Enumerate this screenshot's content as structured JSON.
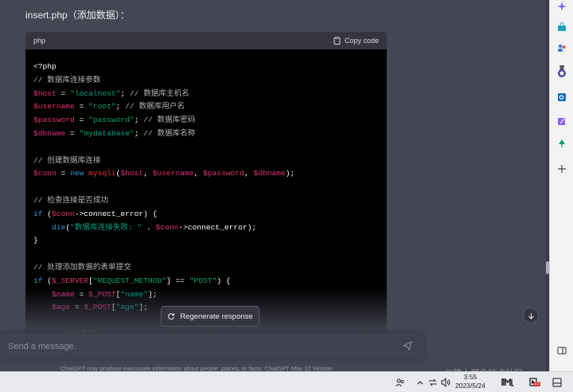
{
  "message": {
    "heading": "insert.php（添加数据）："
  },
  "code": {
    "language": "php",
    "copy_label": "Copy code",
    "lines": [
      [
        {
          "t": "<?php",
          "c": "plain"
        }
      ],
      [
        {
          "t": "// 数据库连接参数",
          "c": "cmt"
        }
      ],
      [
        {
          "t": "$host",
          "c": "var"
        },
        {
          "t": " = ",
          "c": "plain"
        },
        {
          "t": "\"localhost\"",
          "c": "str"
        },
        {
          "t": "; ",
          "c": "plain"
        },
        {
          "t": "// 数据库主机名",
          "c": "cmt"
        }
      ],
      [
        {
          "t": "$username",
          "c": "var"
        },
        {
          "t": " = ",
          "c": "plain"
        },
        {
          "t": "\"root\"",
          "c": "str"
        },
        {
          "t": "; ",
          "c": "plain"
        },
        {
          "t": "// 数据库用户名",
          "c": "cmt"
        }
      ],
      [
        {
          "t": "$password",
          "c": "var"
        },
        {
          "t": " = ",
          "c": "plain"
        },
        {
          "t": "\"password\"",
          "c": "str"
        },
        {
          "t": "; ",
          "c": "plain"
        },
        {
          "t": "// 数据库密码",
          "c": "cmt"
        }
      ],
      [
        {
          "t": "$dbname",
          "c": "var"
        },
        {
          "t": " = ",
          "c": "plain"
        },
        {
          "t": "\"mydatabase\"",
          "c": "str"
        },
        {
          "t": "; ",
          "c": "plain"
        },
        {
          "t": "// 数据库名称",
          "c": "cmt"
        }
      ],
      [],
      [
        {
          "t": "// 创建数据库连接",
          "c": "cmt"
        }
      ],
      [
        {
          "t": "$conn",
          "c": "var"
        },
        {
          "t": " = ",
          "c": "plain"
        },
        {
          "t": "new",
          "c": "kw"
        },
        {
          "t": " ",
          "c": "plain"
        },
        {
          "t": "mysqli",
          "c": "fn"
        },
        {
          "t": "(",
          "c": "plain"
        },
        {
          "t": "$host",
          "c": "var"
        },
        {
          "t": ", ",
          "c": "plain"
        },
        {
          "t": "$username",
          "c": "var"
        },
        {
          "t": ", ",
          "c": "plain"
        },
        {
          "t": "$password",
          "c": "var"
        },
        {
          "t": ", ",
          "c": "plain"
        },
        {
          "t": "$dbname",
          "c": "var"
        },
        {
          "t": ");",
          "c": "plain"
        }
      ],
      [],
      [
        {
          "t": "// 检查连接是否成功",
          "c": "cmt"
        }
      ],
      [
        {
          "t": "if",
          "c": "kw"
        },
        {
          "t": " (",
          "c": "plain"
        },
        {
          "t": "$conn",
          "c": "var"
        },
        {
          "t": "->connect_error) {",
          "c": "plain"
        }
      ],
      [
        {
          "t": "    ",
          "c": "plain"
        },
        {
          "t": "die",
          "c": "kw"
        },
        {
          "t": "(",
          "c": "plain"
        },
        {
          "t": "\"数据库连接失败: \"",
          "c": "str"
        },
        {
          "t": " . ",
          "c": "plain"
        },
        {
          "t": "$conn",
          "c": "var"
        },
        {
          "t": "->connect_error);",
          "c": "plain"
        }
      ],
      [
        {
          "t": "}",
          "c": "plain"
        }
      ],
      [],
      [
        {
          "t": "// 处理添加数据的表单提交",
          "c": "cmt"
        }
      ],
      [
        {
          "t": "if",
          "c": "kw"
        },
        {
          "t": " (",
          "c": "plain"
        },
        {
          "t": "$_SERVER",
          "c": "var"
        },
        {
          "t": "[",
          "c": "plain"
        },
        {
          "t": "\"REQUEST_METHOD\"",
          "c": "str"
        },
        {
          "t": "] == ",
          "c": "plain"
        },
        {
          "t": "\"POST\"",
          "c": "str"
        },
        {
          "t": ") {",
          "c": "plain"
        }
      ],
      [
        {
          "t": "    ",
          "c": "plain"
        },
        {
          "t": "$name",
          "c": "var"
        },
        {
          "t": " = ",
          "c": "plain"
        },
        {
          "t": "$_POST",
          "c": "var"
        },
        {
          "t": "[",
          "c": "plain"
        },
        {
          "t": "\"name\"",
          "c": "str"
        },
        {
          "t": "];",
          "c": "plain"
        }
      ],
      [
        {
          "t": "    ",
          "c": "plain"
        },
        {
          "t": "$age",
          "c": "var"
        },
        {
          "t": " = ",
          "c": "plain"
        },
        {
          "t": "$_POST",
          "c": "var"
        },
        {
          "t": "[",
          "c": "plain"
        },
        {
          "t": "\"age\"",
          "c": "str"
        },
        {
          "t": "];",
          "c": "plain"
        }
      ],
      [],
      [
        {
          "t": "    ",
          "c": "plain"
        },
        {
          "t": "// 插入数据",
          "c": "cmt"
        }
      ]
    ]
  },
  "regenerate": {
    "label": "Regenerate response"
  },
  "composer": {
    "placeholder": "Send a message."
  },
  "disclaimer": "ChatGPT may produce inaccurate information about people, places, or facts. ChatGPT May 12 Version",
  "taskbar": {
    "time": "3:55",
    "date": "2023/5/24",
    "badge": "23"
  },
  "watermark": "@稀土掘金技术社区",
  "colors": {
    "background": "#444654",
    "code_bg": "#000000",
    "string": "#00a67d",
    "variable": "#df3079",
    "keyword": "#2e95d3",
    "comment": "#b4b4b4"
  }
}
